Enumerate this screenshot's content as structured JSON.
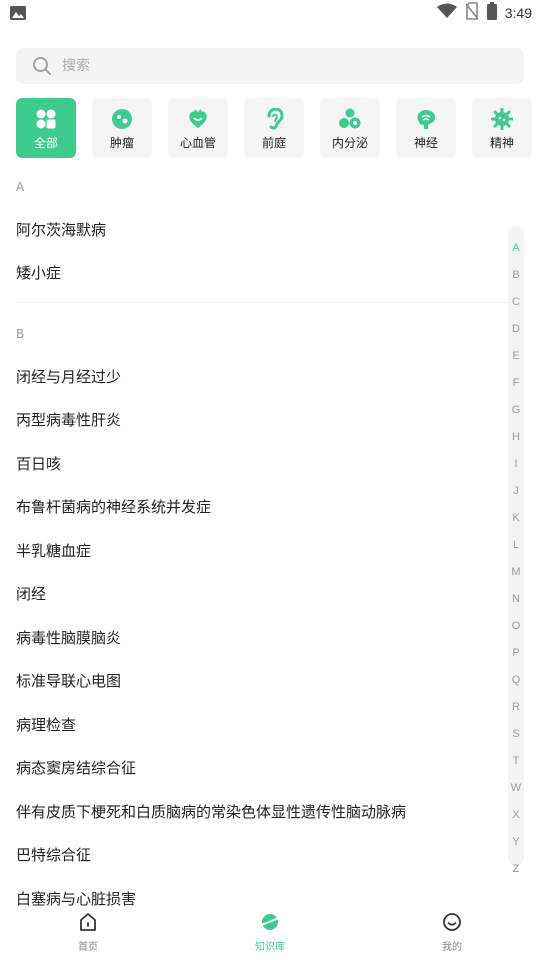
{
  "status_bar": {
    "time": "3:49"
  },
  "search": {
    "placeholder": "搜索"
  },
  "categories": [
    {
      "label": "全部",
      "icon": "grid-icon",
      "active": true
    },
    {
      "label": "肿瘤",
      "icon": "tumor-icon",
      "active": false
    },
    {
      "label": "心血管",
      "icon": "heart-icon",
      "active": false
    },
    {
      "label": "前庭",
      "icon": "ear-icon",
      "active": false
    },
    {
      "label": "内分泌",
      "icon": "endocrine-icon",
      "active": false
    },
    {
      "label": "神经",
      "icon": "brain-icon",
      "active": false
    },
    {
      "label": "精神",
      "icon": "mind-icon",
      "active": false
    }
  ],
  "sections": [
    {
      "letter": "A",
      "items": [
        "阿尔茨海默病",
        "矮小症"
      ]
    },
    {
      "letter": "B",
      "items": [
        "闭经与月经过少",
        "丙型病毒性肝炎",
        "百日咳",
        "布鲁杆菌病的神经系统并发症",
        "半乳糖血症",
        "闭经",
        "病毒性脑膜脑炎",
        "标准导联心电图",
        "病理检查",
        "病态窦房结综合征",
        "伴有皮质下梗死和白质脑病的常染色体显性遗传性脑动脉病",
        "巴特综合征",
        "白塞病与心脏损害"
      ]
    }
  ],
  "alphabet_index": {
    "letters": [
      "A",
      "B",
      "C",
      "D",
      "E",
      "F",
      "G",
      "H",
      "I",
      "J",
      "K",
      "L",
      "M",
      "N",
      "O",
      "P",
      "Q",
      "R",
      "S",
      "T",
      "W",
      "X",
      "Y",
      "Z"
    ],
    "active": "A"
  },
  "bottom_nav": [
    {
      "label": "首页",
      "icon": "home-icon",
      "active": false
    },
    {
      "label": "知识库",
      "icon": "planet-icon",
      "active": true
    },
    {
      "label": "我的",
      "icon": "smiley-icon",
      "active": false
    }
  ],
  "colors": {
    "accent": "#3ecb8e",
    "text": "#222222",
    "muted": "#999999"
  }
}
